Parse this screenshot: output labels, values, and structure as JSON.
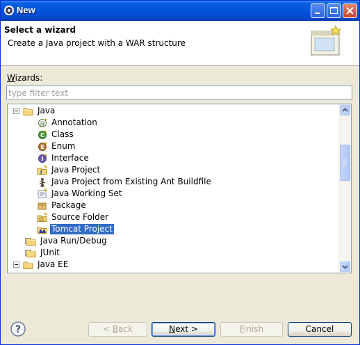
{
  "window": {
    "title": "New"
  },
  "header": {
    "title": "Select a wizard",
    "subtitle": "Create a Java project with a WAR structure"
  },
  "wizards_label": {
    "mnemonic": "W",
    "rest": "izards:"
  },
  "filter": {
    "placeholder": "type filter text",
    "value": ""
  },
  "tree": {
    "items": [
      {
        "label": "Java",
        "icon": "folder-icon",
        "expander": "minus"
      },
      {
        "label": "Annotation",
        "icon": "annotation-icon"
      },
      {
        "label": "Class",
        "icon": "class-icon"
      },
      {
        "label": "Enum",
        "icon": "enum-icon"
      },
      {
        "label": "Interface",
        "icon": "interface-icon"
      },
      {
        "label": "Java Project",
        "icon": "java-project-icon"
      },
      {
        "label": "Java Project from Existing Ant Buildfile",
        "icon": "ant-icon"
      },
      {
        "label": "Java Working Set",
        "icon": "working-set-icon"
      },
      {
        "label": "Package",
        "icon": "package-icon"
      },
      {
        "label": "Source Folder",
        "icon": "source-folder-icon"
      },
      {
        "label": "Tomcat Project",
        "icon": "tomcat-icon",
        "selected": true
      },
      {
        "label": "Java Run/Debug",
        "icon": "folder-icon",
        "expander": "plus"
      },
      {
        "label": "JUnit",
        "icon": "folder-icon",
        "expander": "plus"
      },
      {
        "label": "Java EE",
        "icon": "folder-icon",
        "expander": "minus"
      }
    ]
  },
  "buttons": {
    "back_prefix": "< ",
    "back_mnemonic": "B",
    "back_rest": "ack",
    "next_mnemonic": "N",
    "next_rest": "ext >",
    "finish_mnemonic": "F",
    "finish_rest": "inish",
    "cancel": "Cancel"
  },
  "colors": {
    "selection": "#316ac5",
    "titlebar": "#0254dc",
    "dialog_bg": "#ece9d8"
  }
}
